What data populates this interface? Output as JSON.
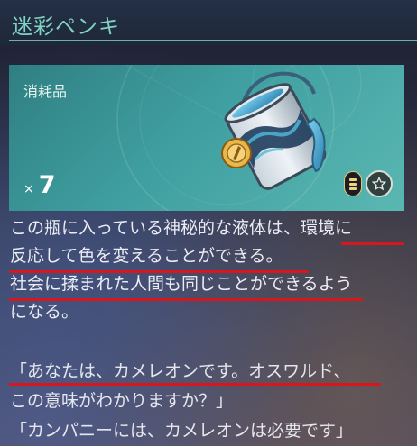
{
  "item": {
    "name": "迷彩ペンキ",
    "category": "消耗品",
    "quantity_prefix": "×",
    "quantity": "7",
    "icon": "camouflage-paint-can"
  },
  "description": {
    "line1": "この瓶に入っている神秘的な液体は、環境に",
    "line2": "反応して色を変えることができる。",
    "line3": "社会に揉まれた人間も同じことができるよう",
    "line4": "になる。"
  },
  "quotes": {
    "line1": "「あなたは、カメレオンです。オスワルド、",
    "line2": "この意味がわかりますか？」",
    "line3": "「カンパニーには、カメレオンは必要です」"
  },
  "colors": {
    "title": "#7fd3c4",
    "card": "#3f9fa0",
    "annotation_underline": "#d8161d",
    "lock_accent": "#f1d27a"
  }
}
